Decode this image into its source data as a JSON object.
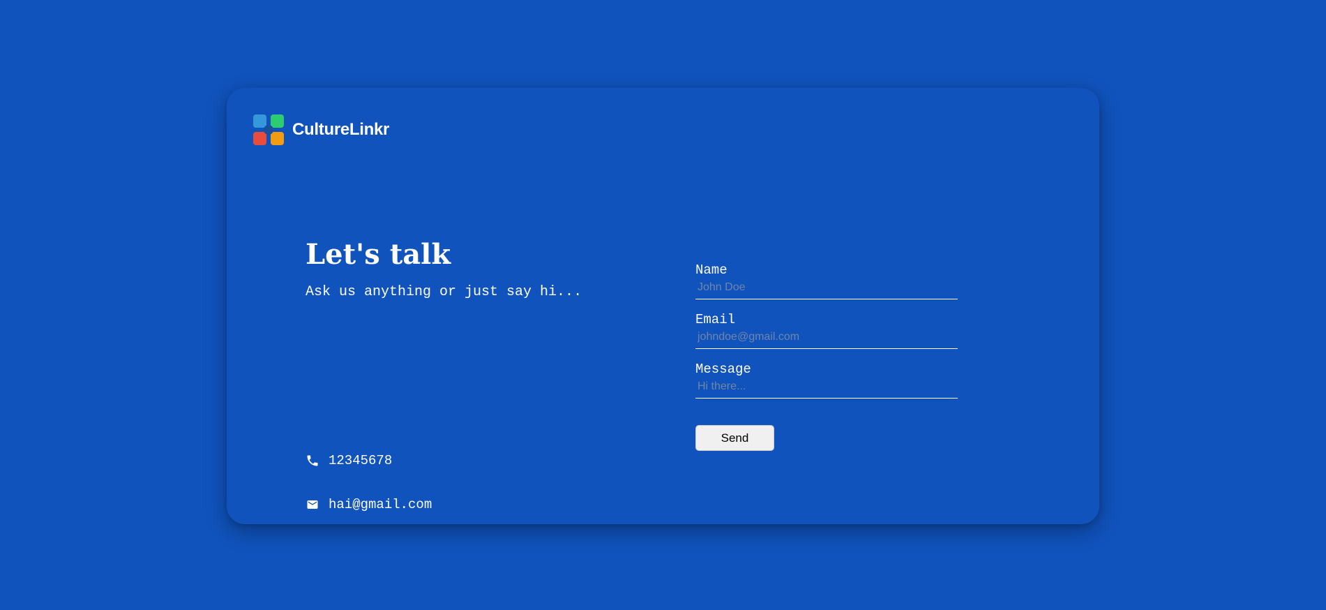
{
  "brand": {
    "name": "CultureLinkr",
    "logo_icon": "four-squares-logo-icon",
    "logo_colors": [
      "#3498db",
      "#2ecc71",
      "#e74c3c",
      "#f39c12"
    ]
  },
  "hero": {
    "title": "Let's talk",
    "subtitle": "Ask us anything or just say hi..."
  },
  "contacts": {
    "phone": {
      "icon": "phone-icon",
      "value": "12345678"
    },
    "email": {
      "icon": "mail-icon",
      "value": "hai@gmail.com"
    }
  },
  "form": {
    "name": {
      "label": "Name",
      "placeholder": "John Doe",
      "value": ""
    },
    "email": {
      "label": "Email",
      "placeholder": "johndoe@gmail.com",
      "value": ""
    },
    "message": {
      "label": "Message",
      "placeholder": "Hi there...",
      "value": ""
    },
    "send_label": "Send"
  },
  "colors": {
    "background": "#1053bc",
    "text": "#ffffff",
    "placeholder": "#6f86a8",
    "button_bg": "#f0f0f0"
  }
}
